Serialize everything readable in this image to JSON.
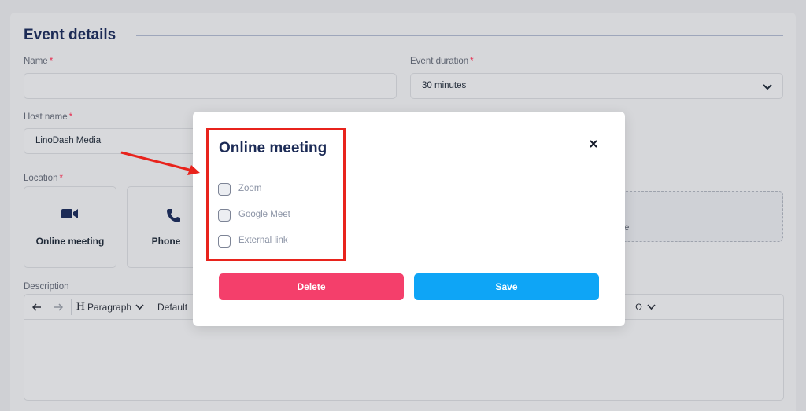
{
  "section": {
    "title": "Event details"
  },
  "fields": {
    "name": {
      "label": "Name",
      "required": "*",
      "value": ""
    },
    "duration": {
      "label": "Event duration",
      "required": "*",
      "value": "30 minutes"
    },
    "host": {
      "label": "Host name",
      "required": "*",
      "value": "LinoDash Media"
    },
    "location": {
      "label": "Location",
      "required": "*"
    },
    "description": {
      "label": "Description"
    }
  },
  "location_tiles": [
    {
      "label": "Online meeting",
      "icon": "video-camera-icon"
    },
    {
      "label": "Phone",
      "icon": "phone-icon"
    }
  ],
  "dashed_tile": {
    "partial_text": "e"
  },
  "editor_toolbar": {
    "undo_icon": "arrow-left-icon",
    "redo_icon": "arrow-right-icon",
    "heading_label": "Paragraph",
    "font_label": "Default",
    "special_char": "Ω"
  },
  "modal": {
    "title": "Online meeting",
    "options": [
      {
        "label": "Zoom",
        "checked": false
      },
      {
        "label": "Google Meet",
        "checked": false
      },
      {
        "label": "External link",
        "checked": false
      }
    ],
    "delete_label": "Delete",
    "save_label": "Save"
  },
  "colors": {
    "title": "#1c2b56",
    "required": "#e53052",
    "delete": "#f43f6b",
    "save": "#0ea5f6",
    "annotation": "#e8231c"
  }
}
